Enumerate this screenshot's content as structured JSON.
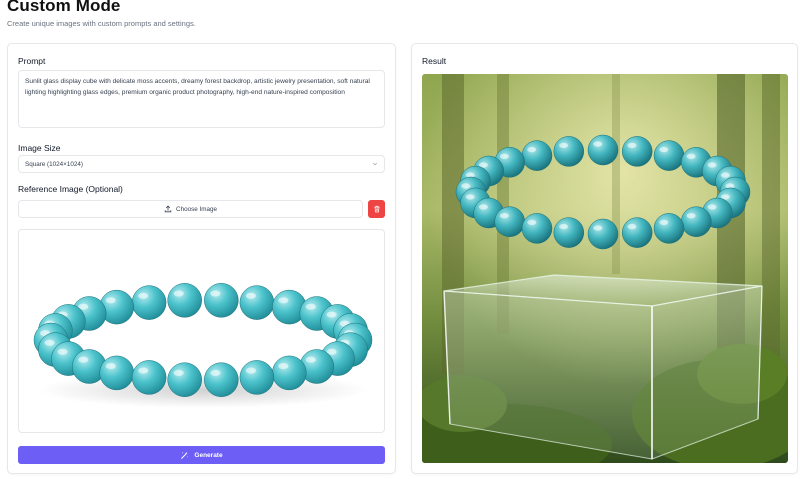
{
  "header": {
    "title": "Custom Mode",
    "subtitle": "Create unique images with custom prompts and settings."
  },
  "form": {
    "prompt_label": "Prompt",
    "prompt_text": "Sunlit glass display cube with delicate moss accents, dreamy forest backdrop, artistic jewelry presentation, soft natural lighting highlighting glass edges, premium organic product photography, high-end nature-inspired composition",
    "size_label": "Image Size",
    "size_value": "Square (1024×1024)",
    "reference_label": "Reference Image (Optional)",
    "choose_label": "Choose Image",
    "generate_label": "Generate"
  },
  "result": {
    "label": "Result"
  },
  "icons": {
    "upload": "upload-icon",
    "trash": "trash-icon",
    "chevron": "chevron-down-icon",
    "wand": "magic-wand-icon"
  },
  "colors": {
    "accent": "#6d5ff5",
    "danger": "#ef4444",
    "bead": "#3fb6c0"
  }
}
